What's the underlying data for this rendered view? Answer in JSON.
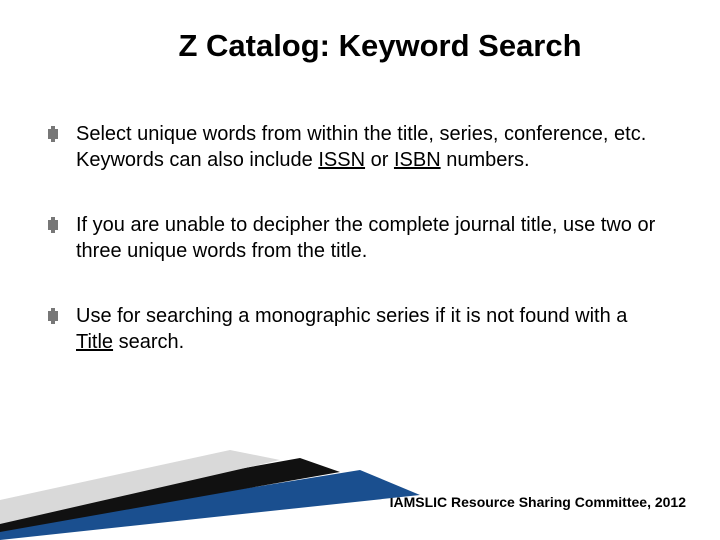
{
  "title": "Z Catalog: Keyword Search",
  "bullets": [
    {
      "pre": "Select unique words from within the title, series, conference, etc. Keywords can also include ",
      "u1": "ISSN",
      "mid": " or ",
      "u2": "ISBN",
      "post": " numbers."
    },
    {
      "pre": "If you are unable to decipher the complete journal title, use two or three unique words from the title.",
      "u1": "",
      "mid": "",
      "u2": "",
      "post": ""
    },
    {
      "pre": "Use for searching a monographic series if it is not found with a ",
      "u1": "Title",
      "mid": " search.",
      "u2": "",
      "post": ""
    }
  ],
  "footer": "IAMSLIC Resource Sharing Committee, 2012"
}
